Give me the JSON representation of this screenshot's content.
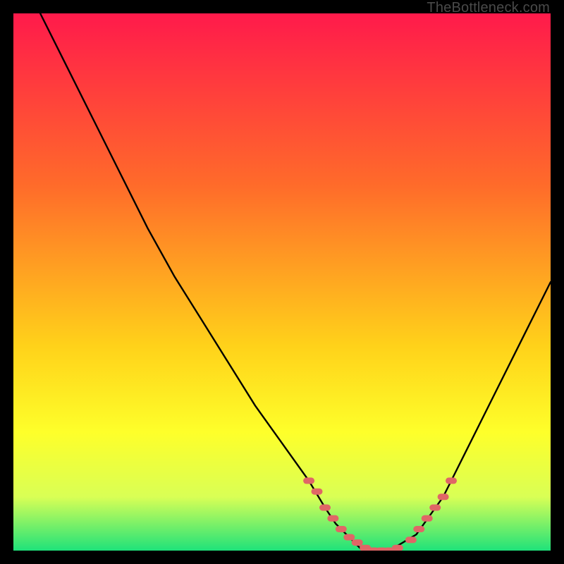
{
  "watermark": "TheBottleneck.com",
  "gradient": {
    "top": "#ff1a4b",
    "c1": "#ff6b2a",
    "c2": "#ffd21a",
    "c3": "#feff2a",
    "c4": "#d9ff55",
    "bottom": "#1fe27a"
  },
  "curve_color": "#000000",
  "marker_color": "#e06666",
  "chart_data": {
    "type": "line",
    "title": "",
    "xlabel": "",
    "ylabel": "",
    "xlim": [
      0,
      100
    ],
    "ylim": [
      0,
      100
    ],
    "series": [
      {
        "name": "bottleneck-curve",
        "x": [
          5,
          10,
          15,
          20,
          25,
          30,
          35,
          40,
          45,
          50,
          55,
          58,
          60,
          63,
          65,
          70,
          75,
          80,
          85,
          90,
          95,
          100
        ],
        "y": [
          100,
          90,
          80,
          70,
          60,
          51,
          43,
          35,
          27,
          20,
          13,
          8,
          5,
          2,
          0,
          0,
          3,
          10,
          20,
          30,
          40,
          50
        ]
      }
    ],
    "markers": {
      "name": "highlight-dots",
      "x": [
        55,
        56.5,
        58,
        59.5,
        61,
        62.5,
        64,
        65.5,
        67,
        68.5,
        70,
        71.5,
        74,
        75.5,
        77,
        78.5,
        80,
        81.5
      ],
      "y": [
        13,
        11,
        8,
        6,
        4,
        2.5,
        1.5,
        0.5,
        0,
        0,
        0,
        0.5,
        2,
        4,
        6,
        8,
        10,
        13
      ]
    }
  }
}
